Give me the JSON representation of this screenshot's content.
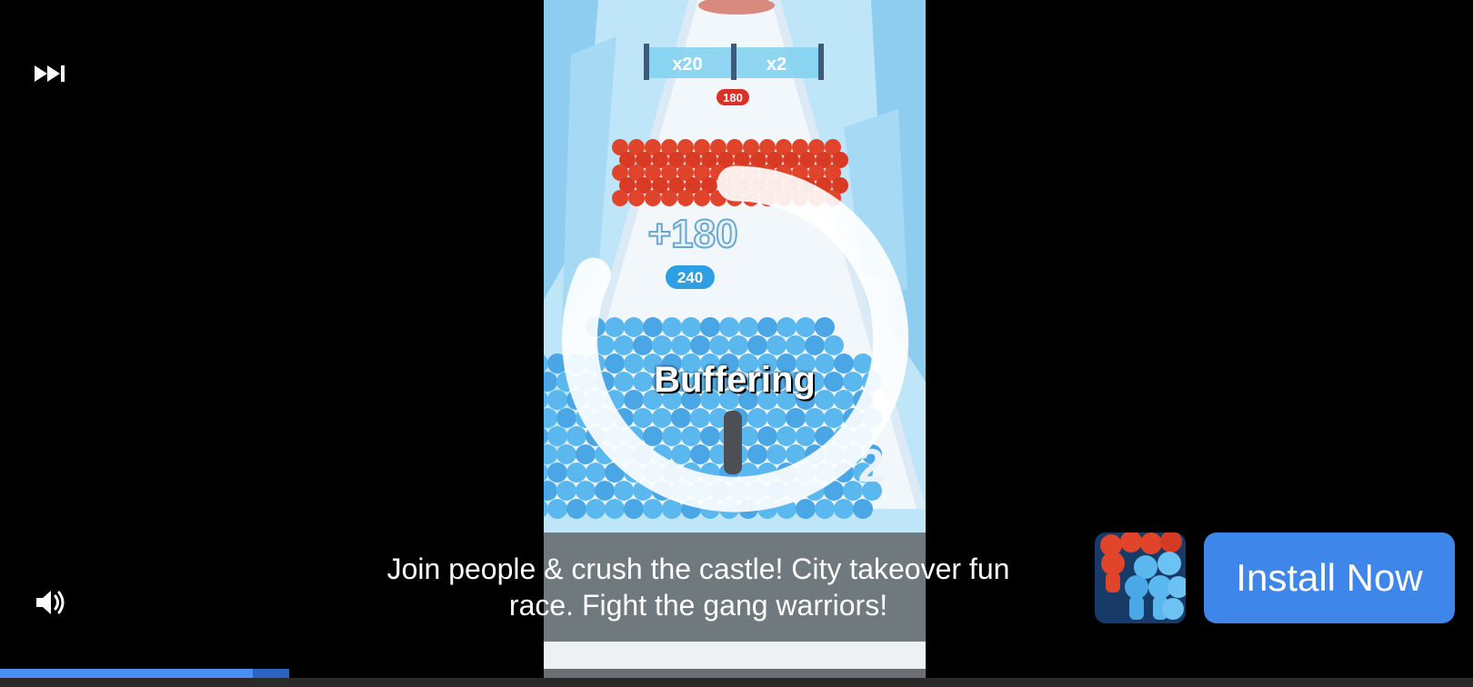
{
  "player": {
    "buffering_text": "Buffering",
    "progress_fraction": 0.165,
    "skip_icon": "skip-forward-icon",
    "volume_icon": "volume-icon"
  },
  "video_overlay": {
    "gate_left": "x20",
    "gate_right": "x2",
    "enemy_count": "180",
    "plus_label": "+180",
    "player_count": "240",
    "partial_label": "2"
  },
  "ad": {
    "description": "Join people & crush the castle! City takeover fun race. Fight the gang warriors!",
    "install_label": "Install Now"
  },
  "colors": {
    "accent": "#3f86ea",
    "crowd_blue": "#5ab8ee",
    "crowd_red": "#e0452c"
  }
}
